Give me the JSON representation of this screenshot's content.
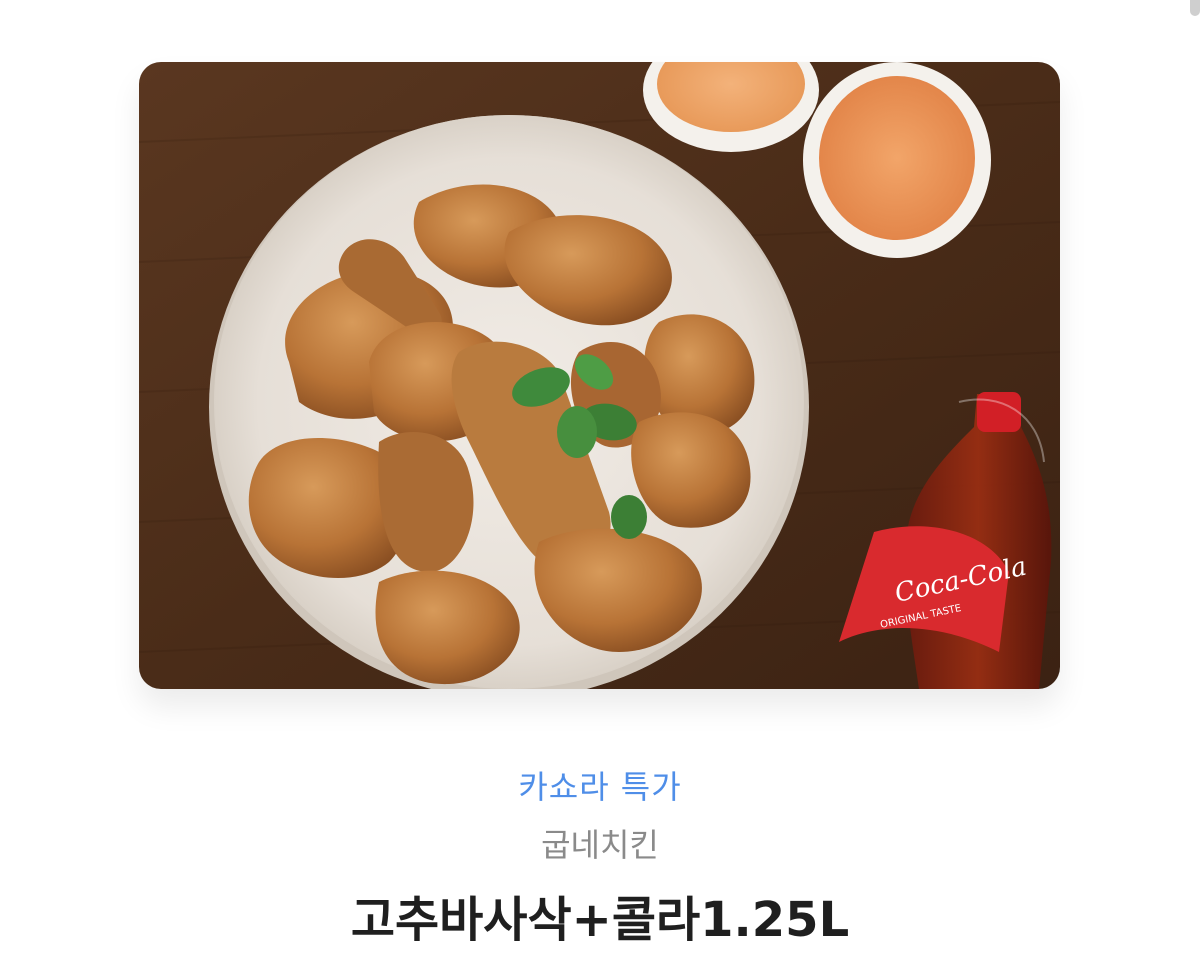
{
  "product": {
    "image_alt": "굽네치킨 고추바사삭+콜라1.25L",
    "promo_label": "카쇼라 특가",
    "brand": "굽네치킨",
    "title": "고추바사삭+콜라1.25L"
  },
  "photo": {
    "bottle_brand": "Coca-Cola",
    "bottle_sub": "ORIGINAL TASTE"
  },
  "colors": {
    "promo": "#4f8ee8",
    "brand": "#8a8a8a",
    "title": "#1f1f1f",
    "table": "#4a2a17"
  }
}
